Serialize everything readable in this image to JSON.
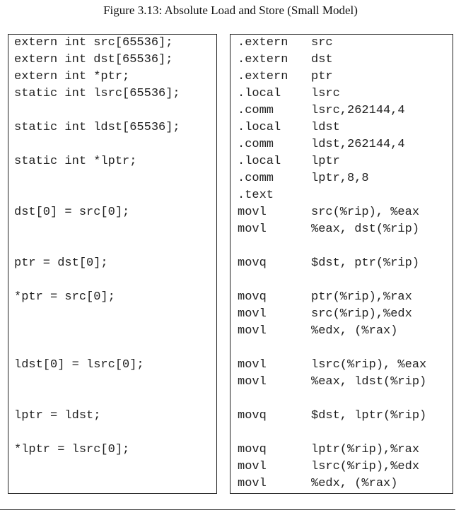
{
  "figure": {
    "caption": "Figure 3.13: Absolute Load and Store (Small Model)"
  },
  "listing": {
    "rows": [
      {
        "c": "extern int src[65536];",
        "op": ".extern",
        "arg": "src"
      },
      {
        "c": "extern int dst[65536];",
        "op": ".extern",
        "arg": "dst"
      },
      {
        "c": "extern int *ptr;",
        "op": ".extern",
        "arg": "ptr"
      },
      {
        "c": "static int lsrc[65536];",
        "op": ".local",
        "arg": "lsrc"
      },
      {
        "c": "",
        "op": ".comm",
        "arg": "lsrc,262144,4"
      },
      {
        "c": "static int ldst[65536];",
        "op": ".local",
        "arg": "ldst"
      },
      {
        "c": "",
        "op": ".comm",
        "arg": "ldst,262144,4"
      },
      {
        "c": "static int *lptr;",
        "op": ".local",
        "arg": "lptr"
      },
      {
        "c": "",
        "op": ".comm",
        "arg": "lptr,8,8"
      },
      {
        "c": "",
        "op": ".text",
        "arg": ""
      },
      {
        "c": "dst[0] = src[0];",
        "op": "movl",
        "arg": "src(%rip), %eax"
      },
      {
        "c": "",
        "op": "movl",
        "arg": "%eax, dst(%rip)"
      },
      {
        "c": "",
        "op": "",
        "arg": ""
      },
      {
        "c": "ptr = dst[0];",
        "op": "movq",
        "arg": "$dst, ptr(%rip)"
      },
      {
        "c": "",
        "op": "",
        "arg": ""
      },
      {
        "c": "*ptr = src[0];",
        "op": "movq",
        "arg": "ptr(%rip),%rax"
      },
      {
        "c": "",
        "op": "movl",
        "arg": "src(%rip),%edx"
      },
      {
        "c": "",
        "op": "movl",
        "arg": "%edx, (%rax)"
      },
      {
        "c": "",
        "op": "",
        "arg": ""
      },
      {
        "c": "ldst[0] = lsrc[0];",
        "op": "movl",
        "arg": "lsrc(%rip), %eax"
      },
      {
        "c": "",
        "op": "movl",
        "arg": "%eax, ldst(%rip)"
      },
      {
        "c": "",
        "op": "",
        "arg": ""
      },
      {
        "c": "lptr = ldst;",
        "op": "movq",
        "arg": "$dst, lptr(%rip)"
      },
      {
        "c": "",
        "op": "",
        "arg": ""
      },
      {
        "c": "*lptr = lsrc[0];",
        "op": "movq",
        "arg": "lptr(%rip),%rax"
      },
      {
        "c": "",
        "op": "movl",
        "arg": "lsrc(%rip),%edx"
      },
      {
        "c": "",
        "op": "movl",
        "arg": "%edx, (%rax)"
      }
    ]
  }
}
